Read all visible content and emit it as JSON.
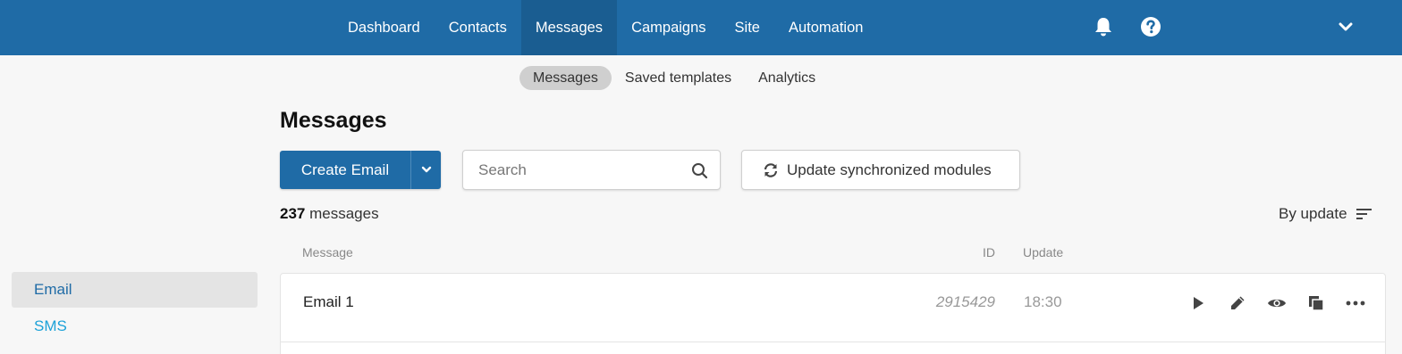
{
  "nav": {
    "items": [
      {
        "label": "Dashboard",
        "active": false
      },
      {
        "label": "Contacts",
        "active": false
      },
      {
        "label": "Messages",
        "active": true
      },
      {
        "label": "Campaigns",
        "active": false
      },
      {
        "label": "Site",
        "active": false
      },
      {
        "label": "Automation",
        "active": false
      }
    ],
    "icons": [
      "bell-icon",
      "help-icon",
      "chevron-down-icon"
    ]
  },
  "subtabs": [
    {
      "label": "Messages",
      "active": true
    },
    {
      "label": "Saved templates",
      "active": false
    },
    {
      "label": "Analytics",
      "active": false
    }
  ],
  "sidebar": {
    "items": [
      {
        "label": "Email",
        "active": true
      },
      {
        "label": "SMS",
        "active": false
      }
    ]
  },
  "main": {
    "title": "Messages",
    "create_label": "Create Email",
    "search_placeholder": "Search",
    "search_value": "",
    "sync_label": "Update synchronized modules",
    "count_number": "237",
    "count_suffix": "messages",
    "sort_label": "By update",
    "columns": {
      "message": "Message",
      "id": "ID",
      "update": "Update"
    },
    "rows": [
      {
        "name": "Email 1",
        "id": "2915429",
        "update": "18:30",
        "actions": [
          "play-icon",
          "pencil-icon",
          "eye-icon",
          "copy-icon",
          "more-icon"
        ]
      }
    ]
  },
  "colors": {
    "topbar": "#1f6ba6",
    "nav_active": "#1a5d91",
    "sms_link": "#1da2d8"
  }
}
